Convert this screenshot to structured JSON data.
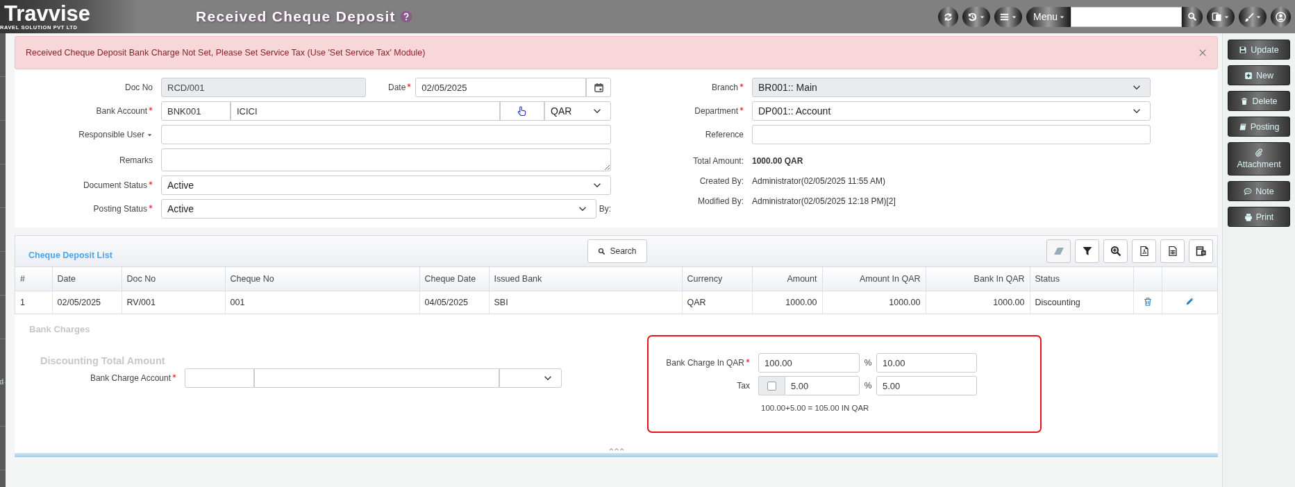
{
  "app": {
    "logo": "Travvise",
    "tagline": "RAVEL SOLUTION PVT LTD",
    "title": "Received Cheque Deposit",
    "menu_label": "Menu"
  },
  "left_strip": {
    "text": "d"
  },
  "alert": {
    "message": "Received Cheque Deposit Bank Charge Not Set, Please Set Service Tax (Use 'Set Service Tax' Module)"
  },
  "form": {
    "left": [
      {
        "fields": [
          {
            "label": "Doc No",
            "required": false,
            "kind": "text",
            "value": "RCD/001",
            "disabled": true
          },
          {
            "label": "Date",
            "required": true,
            "kind": "date",
            "value": "02/05/2025",
            "disabled": false
          }
        ]
      },
      {
        "fields": [
          {
            "label": "Bank Account",
            "required": true,
            "kind": "account",
            "code": "BNK001",
            "value": "ICICI",
            "currency": "QAR",
            "disabled": false
          }
        ]
      },
      {
        "fields": [
          {
            "label": "Responsible User",
            "required": false,
            "dropdown": true,
            "kind": "text",
            "disabled": false
          }
        ]
      },
      {
        "fields": [
          {
            "label": "Remarks",
            "required": false,
            "kind": "textarea",
            "disabled": false
          }
        ]
      },
      {
        "fields": [
          {
            "label": "Document Status",
            "required": true,
            "kind": "select",
            "value": "Active",
            "disabled": false
          }
        ]
      },
      {
        "fields": [
          {
            "label": "Posting Status",
            "required": true,
            "kind": "select",
            "value": "Active",
            "suffix": "By:",
            "disabled": false
          }
        ]
      }
    ],
    "right": [
      {
        "label": "Branch",
        "required": true,
        "kind": "select",
        "value": "BR001:: Main",
        "disabled": true
      },
      {
        "label": "Department",
        "required": true,
        "kind": "select",
        "value": "DP001:: Account",
        "disabled": false
      },
      {
        "label": "Reference",
        "required": false,
        "kind": "text",
        "disabled": false
      },
      {
        "label": "Total Amount:",
        "kind": "info",
        "value": "1000.00 QAR",
        "bold": true
      },
      {
        "label": "Created By:",
        "kind": "info",
        "value": "Administrator(02/05/2025 11:55 AM)",
        "bold": false
      },
      {
        "label": "Modified By:",
        "kind": "info",
        "value": "Administrator(02/05/2025 12:18 PM)[2]",
        "bold": false
      }
    ]
  },
  "list": {
    "title": "Cheque Deposit List",
    "search_label": "Search",
    "tools": [
      {
        "disabled": true
      },
      {
        "disabled": false
      },
      {
        "disabled": false
      },
      {
        "disabled": false
      },
      {
        "disabled": false
      },
      {
        "disabled": false
      }
    ],
    "columns": [
      {
        "label": "#",
        "numeric": false
      },
      {
        "label": "Date",
        "numeric": false
      },
      {
        "label": "Doc No",
        "numeric": false
      },
      {
        "label": "Cheque No",
        "numeric": false
      },
      {
        "label": "Cheque Date",
        "numeric": false
      },
      {
        "label": "Issued Bank",
        "numeric": false
      },
      {
        "label": "Currency",
        "numeric": false
      },
      {
        "label": "Amount",
        "numeric": true
      },
      {
        "label": "Amount In QAR",
        "numeric": true
      },
      {
        "label": "Bank In QAR",
        "numeric": true
      },
      {
        "label": "Status",
        "numeric": false
      }
    ],
    "rows": [
      {
        "cells": [
          "1",
          "02/05/2025",
          "RV/001",
          "001",
          "04/05/2025",
          "SBI",
          "QAR",
          "1000.00",
          "1000.00",
          "1000.00",
          "Discounting"
        ]
      }
    ]
  },
  "bank_charges": {
    "title": "Bank Charges",
    "subtitle": "Discounting Total Amount",
    "account_label": "Bank Charge Account",
    "account_required": true,
    "calc": [
      {
        "label": "Bank Charge In QAR",
        "required": true,
        "kind": "amount",
        "value": "100.00",
        "percent_sign": "%",
        "percent": "10.00"
      },
      {
        "label": "Tax",
        "required": false,
        "kind": "tax",
        "checked": false,
        "value": "5.00",
        "percent_sign": "%",
        "percent": "5.00"
      }
    ],
    "summary": "100.00+5.00 = 105.00 IN QAR"
  },
  "actions": [
    {
      "label": "Update"
    },
    {
      "label": "New"
    },
    {
      "label": "Delete"
    },
    {
      "label": "Posting"
    },
    {
      "label": "Attachment"
    },
    {
      "label": "Note"
    },
    {
      "label": "Print"
    }
  ]
}
